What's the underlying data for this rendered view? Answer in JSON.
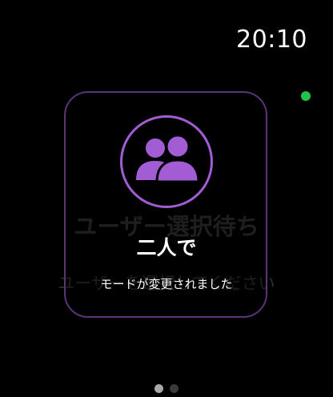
{
  "status_bar": {
    "time": "20:10"
  },
  "background_screen": {
    "title": "ユーザー選択待ち",
    "subtitle": "ユーザーを選択してください"
  },
  "hud": {
    "icon": "two-people-icon",
    "title": "二人で",
    "message": "モードが変更されました"
  },
  "pagination": {
    "count": 2,
    "active_index": 0
  },
  "colors": {
    "accent": "#a25cd4",
    "indicator": "#1fc44a",
    "background": "#000000"
  }
}
